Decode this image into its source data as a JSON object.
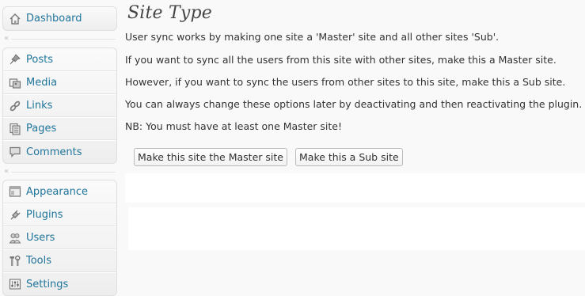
{
  "menu": {
    "dashboard": {
      "label": "Dashboard",
      "icon": "home-icon"
    },
    "collapse_symbol": "«",
    "content_items": [
      {
        "id": "posts",
        "label": "Posts",
        "icon": "pushpin-icon"
      },
      {
        "id": "media",
        "label": "Media",
        "icon": "media-icon"
      },
      {
        "id": "links",
        "label": "Links",
        "icon": "link-icon"
      },
      {
        "id": "pages",
        "label": "Pages",
        "icon": "pages-icon"
      },
      {
        "id": "comments",
        "label": "Comments",
        "icon": "comment-icon"
      }
    ],
    "admin_items": [
      {
        "id": "appearance",
        "label": "Appearance",
        "icon": "appearance-icon"
      },
      {
        "id": "plugins",
        "label": "Plugins",
        "icon": "plugin-icon"
      },
      {
        "id": "users",
        "label": "Users",
        "icon": "users-icon"
      },
      {
        "id": "tools",
        "label": "Tools",
        "icon": "tools-icon"
      },
      {
        "id": "settings",
        "label": "Settings",
        "icon": "settings-icon"
      }
    ]
  },
  "main": {
    "title": "Site Type",
    "paragraphs": [
      "User sync works by making one site a 'Master' site and all other sites 'Sub'.",
      "If you want to sync all the users from this site with other sites, make this a Master site.",
      "However, if you want to sync the users from other sites to this site, make this a Sub site.",
      "You can always change these options later by deactivating and then reactivating the plugin.",
      "NB: You must have at least one Master site!"
    ],
    "buttons": {
      "master": "Make this site the Master site",
      "sub": "Make this a Sub site"
    }
  },
  "colors": {
    "link": "#21759b",
    "background": "#f9f9f9",
    "title": "#464646"
  }
}
